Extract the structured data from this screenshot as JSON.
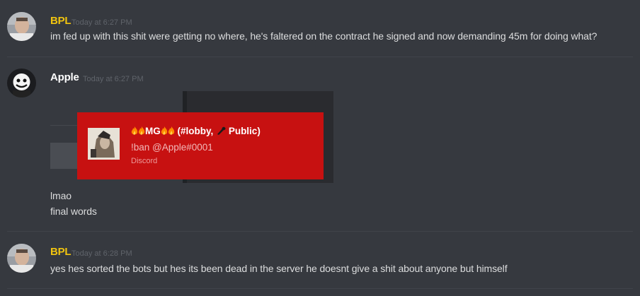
{
  "colors": {
    "background": "#36393f",
    "bpl_name": "#f1c40f",
    "apple_name": "#ffffff",
    "message_text": "#dcddde",
    "timestamp": "#5f636a",
    "embed_red": "#c71111"
  },
  "messages": [
    {
      "username": "BPL",
      "timestamp": "Today at 6:27 PM",
      "lines": [
        "im fed up with this shit were getting no where, he's faltered on the contract he signed and now demanding 45m for doing what?"
      ]
    },
    {
      "username": "Apple",
      "timestamp": "Today at 6:27 PM",
      "embed": {
        "title_prefix": "MG",
        "title_suffix": "(#lobby,",
        "title_end": "Public)",
        "line": "!ban @Apple#0001",
        "footer": "Discord",
        "icons": [
          "fire-icon",
          "fire-icon",
          "fire-icon",
          "fire-icon",
          "microphone-icon"
        ]
      },
      "lines": [
        "lmao",
        "final words"
      ]
    },
    {
      "username": "BPL",
      "timestamp": "Today at 6:28 PM",
      "lines": [
        "yes hes sorted the bots but hes its been dead in the server he doesnt give a shit about anyone but himself"
      ]
    }
  ]
}
